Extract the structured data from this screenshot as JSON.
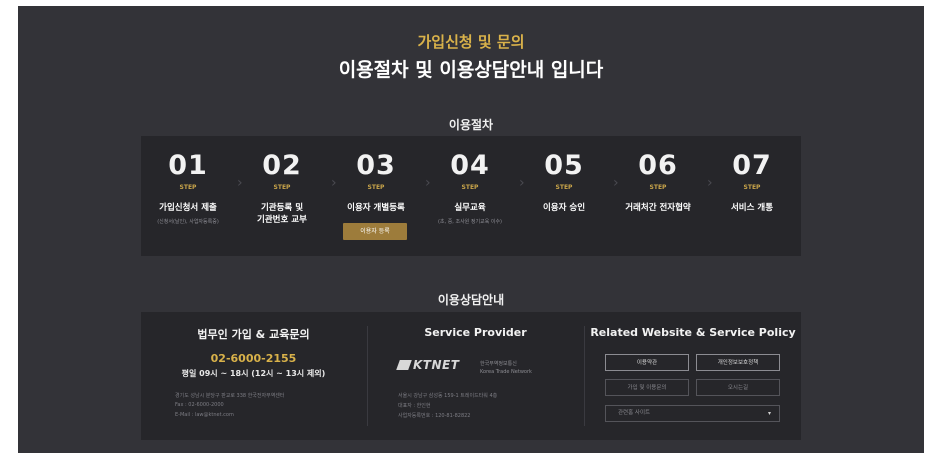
{
  "header": {
    "eyebrow": "가입신청 및 문의",
    "headline": "이용절차 및 이용상담안내 입니다"
  },
  "procedure": {
    "title": "이용절차",
    "steps": [
      {
        "num": "01",
        "tag": "STEP",
        "label": "가입신청서 제출",
        "sub": "(신청서(날인), 사업자등록증)"
      },
      {
        "num": "02",
        "tag": "STEP",
        "label": "기관등록 및\n기관번호 교부",
        "sub": ""
      },
      {
        "num": "03",
        "tag": "STEP",
        "label": "이용자 개별등록",
        "sub": "",
        "button": "이용자 등록"
      },
      {
        "num": "04",
        "tag": "STEP",
        "label": "실무교육",
        "sub": "(초, 중, 조사원 정기교육 이수)"
      },
      {
        "num": "05",
        "tag": "STEP",
        "label": "이용자 승인",
        "sub": ""
      },
      {
        "num": "06",
        "tag": "STEP",
        "label": "거래처간 전자협약",
        "sub": ""
      },
      {
        "num": "07",
        "tag": "STEP",
        "label": "서비스 개통",
        "sub": ""
      }
    ]
  },
  "consult": {
    "title": "이용상담안내",
    "contact": {
      "title": "법무인 가입 & 교육문의",
      "phone": "02-6000-2155",
      "hours": "평일 09시 ~ 18시 (12시 ~ 13시 제외)",
      "address": "경기도 성남시 분당구 판교로 338 한국전자무역센터",
      "fax": "Fax : 02-6000-2000",
      "email": "E-Mail : law@ktnet.com"
    },
    "provider": {
      "title": "Service Provider",
      "logo_text": "KTNET",
      "org_ko": "한국무역정보통신",
      "org_en": "Korea Trade Network",
      "address": "서울시 강남구 삼성동 159-1 트레이드타워 4층",
      "ceo": "대표자 : 한인현",
      "bizno": "사업자등록번호 : 120-81-82822"
    },
    "related": {
      "title": "Related Website & Service Policy",
      "buttons": [
        "이용약관",
        "개인정보보호정책",
        "가입 및 이용문의",
        "오시는길"
      ],
      "select": "관련홈 사이트",
      "select_caret": "▾"
    }
  },
  "colors": {
    "background": "#333338",
    "panel": "#26262a",
    "gold": "#d9b24a",
    "button_gold": "#9d7c3b"
  }
}
